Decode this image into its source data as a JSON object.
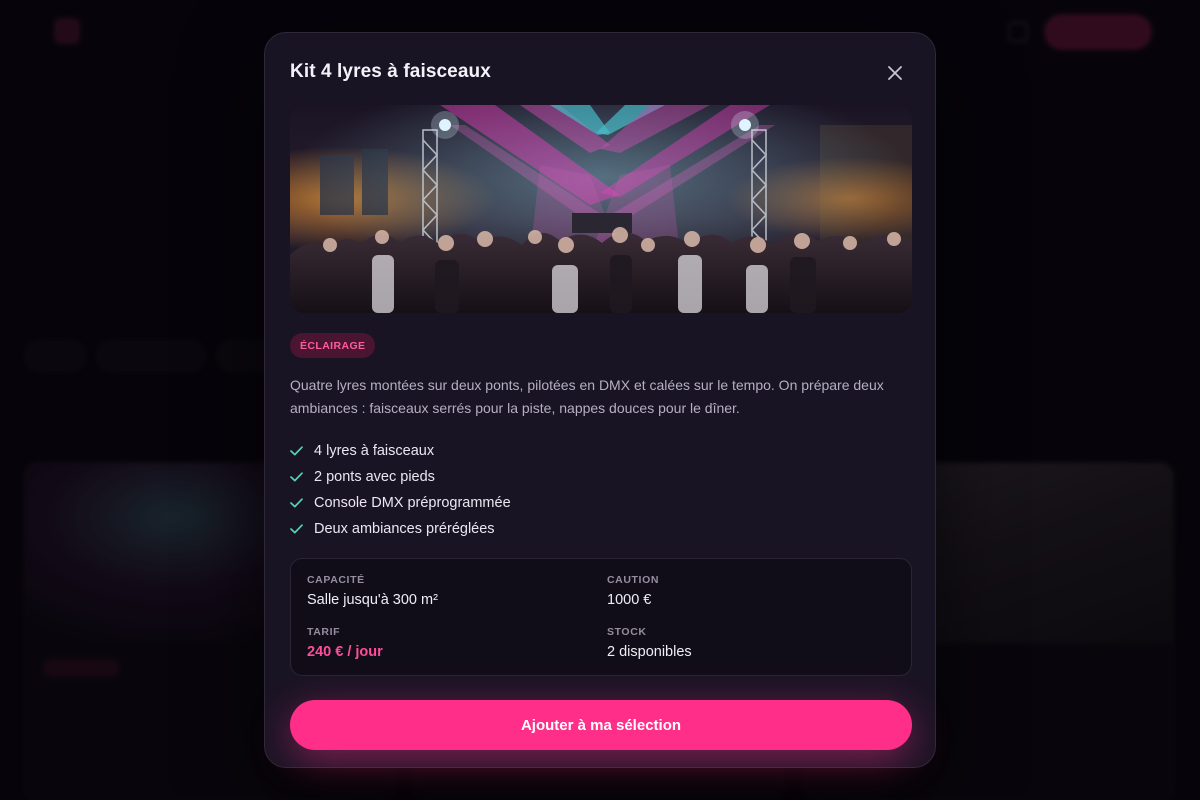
{
  "modal": {
    "title": "Kit 4 lyres à faisceaux",
    "close_icon": "close-icon",
    "image_alt": "Soirée dansante éclairée par des lyres",
    "category_tag": "ÉCLAIRAGE",
    "description": "Quatre lyres montées sur deux ponts, pilotées en DMX et calées sur le tempo. On prépare deux ambiances : faisceaux serrés pour la piste, nappes douces pour le dîner.",
    "features": [
      "4 lyres à faisceaux",
      "2 ponts avec pieds",
      "Console DMX préprogrammée",
      "Deux ambiances préréglées"
    ],
    "specs": {
      "capacity_label": "CAPACITÉ",
      "capacity_value": "Salle jusqu'à 300 m²",
      "deposit_label": "CAUTION",
      "deposit_value": "1000 €",
      "rate_label": "TARIF",
      "rate_value": "240 € / jour",
      "stock_label": "STOCK",
      "stock_value": "2 disponibles"
    },
    "cta_label": "Ajouter à ma sélection"
  },
  "colors": {
    "accent": "#ff2e88",
    "accent_text": "#ff4d9a",
    "check": "#4fd6b5",
    "modal_bg": "#191424",
    "page_bg": "#07060b"
  }
}
